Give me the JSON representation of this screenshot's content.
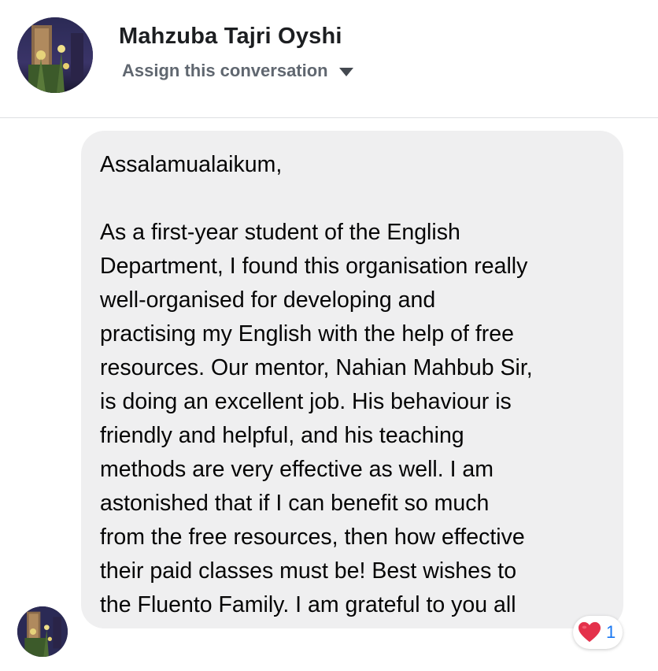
{
  "header": {
    "name": "Mahzuba Tajri Oyshi",
    "assign_label": "Assign this conversation"
  },
  "message": {
    "lines": [
      "Assalamualaikum,",
      "",
      "As a first-year student of the English",
      "Department, I found this organisation really",
      "well-organised for developing and",
      "practising my English with the help of free",
      "resources. Our mentor, Nahian Mahbub Sir,",
      "is doing an excellent job. His behaviour is",
      "friendly and helpful, and his teaching",
      "methods are very effective as well. I am",
      "astonished that if I can benefit so much",
      "from the free resources, then how effective",
      "their paid classes must be! Best wishes to",
      "the Fluento Family. I am grateful to you all"
    ]
  },
  "reaction": {
    "icon": "heart-icon",
    "count": "1",
    "color": "#e4314b"
  },
  "colors": {
    "bubble": "#efeff0",
    "count_text": "#1877f2",
    "secondary_text": "#606770"
  }
}
